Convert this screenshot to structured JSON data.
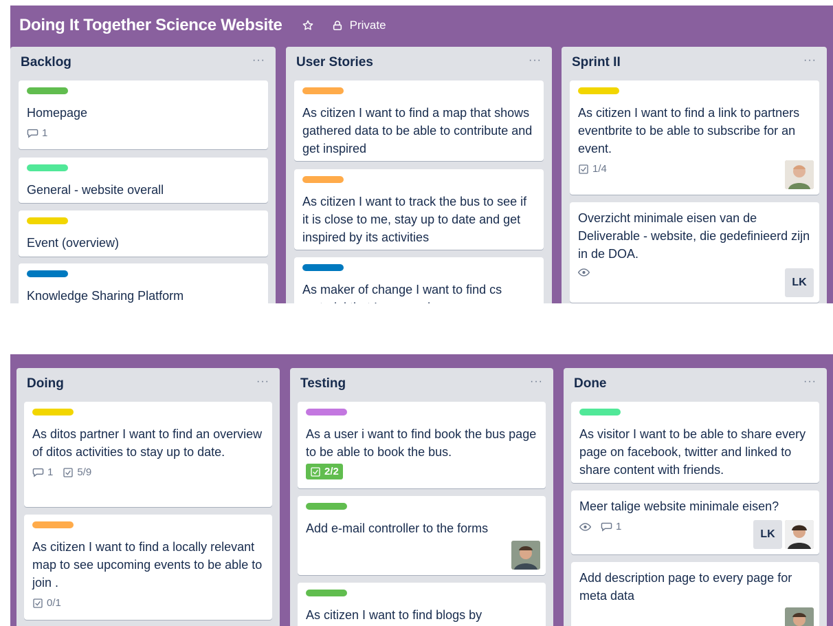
{
  "top_board": {
    "title": "Doing It Together Science Website",
    "star_icon": "star-icon",
    "visibility_icon": "lock-icon",
    "visibility": "Private",
    "lists": [
      {
        "title": "Backlog",
        "menu": "···",
        "cards": [
          {
            "label_color": "#61bd4f",
            "text": "Homepage",
            "comments": "1"
          },
          {
            "label_color": "#51e898",
            "text": "General - website overall"
          },
          {
            "label_color": "#f2d600",
            "text": "Event (overview)"
          },
          {
            "label_color": "#0079bf",
            "text": "Knowledge Sharing Platform"
          }
        ]
      },
      {
        "title": "User Stories",
        "menu": "···",
        "cards": [
          {
            "label_color": "#ffab4a",
            "text": "As citizen I want to find a map that shows gathered data to be able to contribute and get inspired"
          },
          {
            "label_color": "#ffab4a",
            "text": "As citizen I want to track the bus to see if it is close to me, stay up to date and get inspired by its activities"
          },
          {
            "label_color": "#0079bf",
            "text": "As maker of change I want to find cs material that I can use in my own"
          }
        ]
      },
      {
        "title": "Sprint II",
        "menu": "···",
        "cards": [
          {
            "label_color": "#f2d600",
            "text": "As citizen I want to find a link to partners eventbrite to be able to subscribe for an event.",
            "checklist": "1/4"
          },
          {
            "text": "Overzicht minimale eisen van de Deliverable - website, die gedefinieerd zijn in de DOA.",
            "member": "LK"
          }
        ]
      }
    ]
  },
  "bottom_board": {
    "lists": [
      {
        "title": "Doing",
        "menu": "···",
        "cards": [
          {
            "label_color": "#f2d600",
            "text": "As ditos partner I want to find an overview of ditos activities to stay up to date.",
            "comments": "1",
            "checklist": "5/9"
          },
          {
            "label_color": "#ffab4a",
            "text": "As citizen I want to find a locally relevant map to see upcoming events to be able to join .",
            "checklist": "0/1"
          }
        ]
      },
      {
        "title": "Testing",
        "menu": "···",
        "cards": [
          {
            "label_color": "#c377e0",
            "text": "As a user i want to find book the bus page to be able to book the bus.",
            "checklist": "2/2"
          },
          {
            "label_color": "#61bd4f",
            "text": "Add e-mail controller to the forms"
          },
          {
            "label_color": "#61bd4f",
            "text": "As citizen I want to find blogs by"
          }
        ]
      },
      {
        "title": "Done",
        "menu": "···",
        "cards": [
          {
            "label_color": "#51e898",
            "text": "As visitor I want to be able to share every page on facebook, twitter and linked to share content with friends."
          },
          {
            "text": "Meer talige website minimale eisen?",
            "comments": "1",
            "member": "LK"
          },
          {
            "text": "Add description page to every page for meta data"
          }
        ]
      }
    ]
  }
}
